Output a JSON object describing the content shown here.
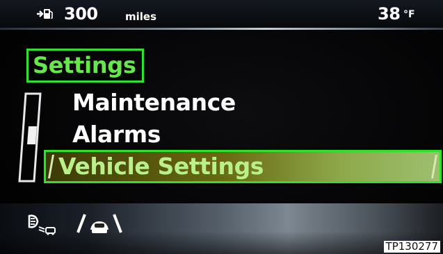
{
  "status_bar": {
    "fuel_icon": "fuel-pump-icon",
    "range_value": "300",
    "range_unit": "miles",
    "temperature_value": "38",
    "temperature_unit": "°F"
  },
  "settings": {
    "title": "Settings"
  },
  "menu": {
    "items": [
      {
        "label": "Maintenance",
        "selected": false
      },
      {
        "label": "Alarms",
        "selected": false
      },
      {
        "label": "Vehicle Settings",
        "selected": true
      }
    ]
  },
  "bottom_bar": {
    "icons": [
      "auto-headlamp-icon",
      "lane-assist-icon"
    ]
  },
  "photo_id": "TP130277",
  "colors": {
    "highlight_green": "#2fe12b",
    "title_text": "#67e84a",
    "selected_text": "#b9f08a",
    "background": "#000000"
  }
}
